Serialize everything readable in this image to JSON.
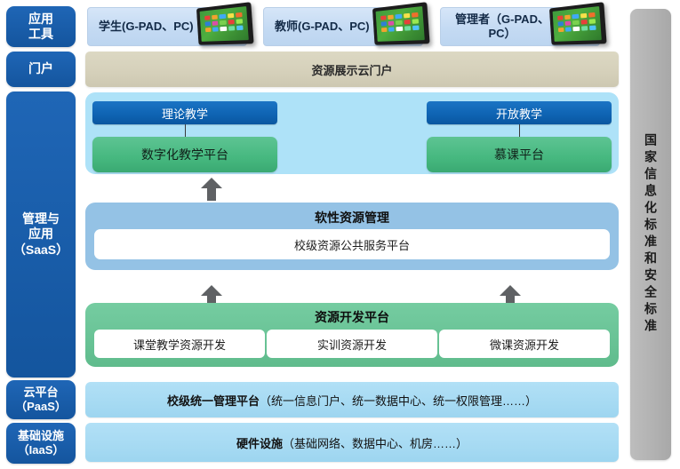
{
  "layers": {
    "app_tools": "应用\n工具",
    "app_tools_l1": "应用",
    "app_tools_l2": "工具",
    "portal": "门户",
    "saas_l1": "管理与",
    "saas_l2": "应用",
    "saas_l3": "（SaaS）",
    "paas_l1": "云平台",
    "paas_l2": "（PaaS）",
    "iaas_l1": "基础设施",
    "iaas_l2": "（IaaS）"
  },
  "right_band": {
    "label": "国家信息化标准和安全标准"
  },
  "devices": [
    {
      "label": "学生(G-PAD、PC)",
      "icon": "tablet-icon"
    },
    {
      "label": "教师(G-PAD、PC)",
      "icon": "tablet-icon"
    },
    {
      "label": "管理者（G-PAD、PC）",
      "icon": "tablet-icon"
    }
  ],
  "portal_bar": {
    "label": "资源展示云门户"
  },
  "teaching_panel": {
    "columns": [
      {
        "head": "理论教学",
        "body": "数字化教学平台"
      },
      {
        "head": "开放教学",
        "body": "慕课平台"
      }
    ]
  },
  "soft_resource_panel": {
    "title": "软性资源管理",
    "item": "校级资源公共服务平台"
  },
  "resource_dev_panel": {
    "title": "资源开发平台",
    "items": [
      "课堂教学资源开发",
      "实训资源开发",
      "微课资源开发"
    ]
  },
  "bottom_bars": {
    "paas": {
      "bold": "校级统一管理平台",
      "tail": "（统一信息门户、统一数据中心、统一权限管理……）"
    },
    "iaas": {
      "bold": "硬件设施",
      "tail": "（基础网络、数据中心、机房……）"
    }
  },
  "colors": {
    "sidebar_blue": "#14559e",
    "teaching_panel": "#aee2f8",
    "teach_head_blue": "#0e63b2",
    "teach_body_green": "#46b87f",
    "soft_panel_blue": "#94c2e5",
    "resdev_green": "#66c193",
    "bottom_bar_blue": "#a4d9f2",
    "portal_beige": "#d5d0ba",
    "right_band_gray": "#b2b2b2",
    "arrow_gray": "#5f6164"
  }
}
